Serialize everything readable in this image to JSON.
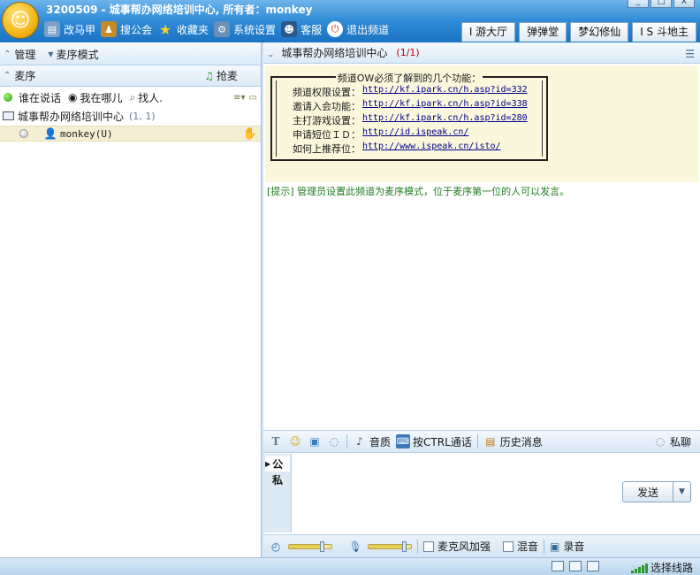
{
  "window": {
    "title": "3200509 - 城事帮办网络培训中心, 所有者：monkey",
    "min_glyph": "_",
    "max_glyph": "□",
    "close_glyph": "X"
  },
  "toolbar": {
    "items": [
      {
        "label": "改马甲",
        "icon": "id-card-icon",
        "color": "#7aa0c8"
      },
      {
        "label": "搜公会",
        "icon": "guild-icon",
        "color": "#c58a2a"
      },
      {
        "label": "收藏夹",
        "icon": "star-icon",
        "color": "#f2c21a"
      },
      {
        "label": "系统设置",
        "icon": "settings-icon",
        "color": "#6a90b8"
      },
      {
        "label": "客服",
        "icon": "service-icon",
        "color": "#2a5a8a"
      },
      {
        "label": "退出频道",
        "icon": "power-icon",
        "color": "#d23a2a"
      }
    ]
  },
  "app_tabs": [
    "I 游大厅",
    "弹弹堂",
    "梦幻修仙",
    "I S 斗地主"
  ],
  "left_panel": {
    "manage_label": "管理",
    "mode_label": "麦序模式",
    "queue_label": "麦序",
    "grab_mic_label": "抢麦",
    "tools": {
      "who_speaking": "谁在说话",
      "where_am_i": "我在哪儿",
      "find_person": "找人."
    },
    "channel": {
      "name": "城事帮办网络培训中心",
      "count": "(1, 1)"
    },
    "user": {
      "name": "monkey(U)"
    }
  },
  "right_panel": {
    "channel_title": "城事帮办网络培训中心",
    "channel_count": "(1/1)",
    "notice": {
      "title": "频道OW必须了解到的几个功能：",
      "lines": [
        {
          "label": "频道权限设置：",
          "url": "http://kf.ipark.cn/h.asp?id=332"
        },
        {
          "label": "邀请入会功能：",
          "url": "http://kf.ipark.cn/h.asp?id=338"
        },
        {
          "label": "主打游戏设置：",
          "url": "http://kf.ipark.cn/h.asp?id=280"
        },
        {
          "label": "申请短位ＩＤ：",
          "url": "http://id.ispeak.cn/"
        },
        {
          "label": "如何上推荐位：",
          "url": "http://www.ispeak.cn/isto/"
        }
      ]
    },
    "hint_text": "[提示] 管理员设置此频道为麦序模式，位于麦序第一位的人可以发言。",
    "input_toolbar": {
      "quality": "音质",
      "ctrl_talk": "按CTRL通话",
      "history": "历史消息",
      "private_chat": "私聊"
    },
    "compose": {
      "public_tab": "公",
      "private_tab": "私",
      "send_label": "发送"
    },
    "audio": {
      "speaker_volume": 0.8,
      "mic_volume": 0.85,
      "mic_boost_label": "麦克风加强",
      "mix_label": "混音",
      "record_label": "录音"
    }
  },
  "statusbar": {
    "route_label": "选择线路"
  }
}
